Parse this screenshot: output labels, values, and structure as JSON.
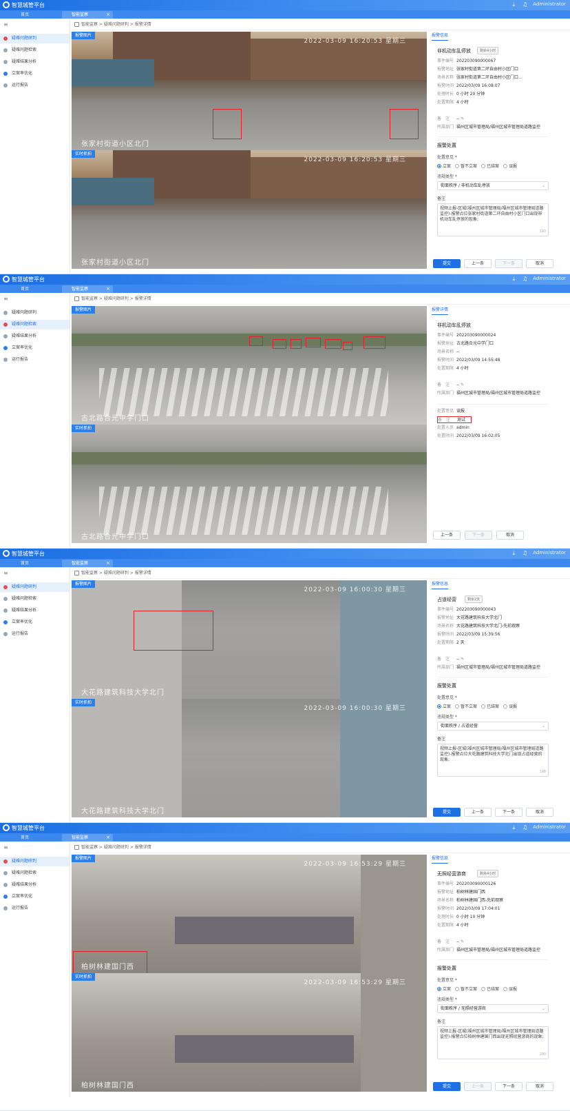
{
  "app": {
    "title": "智慧城管平台",
    "user": "Administrator",
    "download_icon": "download-icon",
    "bell_icon": "bell-icon"
  },
  "tabs": [
    "首页",
    "智能监察"
  ],
  "sidebar": {
    "items": [
      {
        "label": "疑难问题研判"
      },
      {
        "label": "疑难问题检索"
      },
      {
        "label": "疑难结果分析"
      },
      {
        "label": "立案率优化"
      },
      {
        "label": "运行报告"
      }
    ]
  },
  "breadcrumb": [
    "智能监察",
    "疑难问题研判",
    "报警详情"
  ],
  "image_labels": {
    "alarm": "报警图片",
    "live": "实时抓拍"
  },
  "panels": [
    {
      "active_menu": 0,
      "stamp": "2022-03-09 16:20:53 星期三",
      "caption": "张家村街道小区北门",
      "detail_tab": "报警信息",
      "title": "非机动车乱停放",
      "badge": "剩余4小时",
      "rows": [
        {
          "k": "事件编号",
          "v": "202203090000067"
        },
        {
          "k": "报警地址",
          "v": "张家村街道第二环自由村小区门口"
        },
        {
          "k": "场景名称",
          "v": "张家村街道第二环自由村小区门口..."
        },
        {
          "k": "报警时间",
          "v": "2022/03/09 16:08:07"
        },
        {
          "k": "处理时长",
          "v": "0 小时 20 分钟"
        },
        {
          "k": "处置期限",
          "v": "4 小时"
        }
      ],
      "rows2": [
        {
          "k": "备　注",
          "v": "--"
        },
        {
          "k": "所属部门",
          "v": "福州区城市管理局/福州区城市管理局道路监控"
        }
      ],
      "section": "报警处置",
      "field_label": "处置意见 *",
      "radios": [
        "立案",
        "暂不立案",
        "已结案",
        "误报"
      ],
      "type_label": "违规类型 *",
      "type_value": "街面秩序 / 非机动车乱停放",
      "note_label": "备注",
      "note": "视频上报-区城(福州区城市管理局/福州区城市管理局道路监控)-报警点位张家村街道第二环自由村小区门口出现非机动车乱停放的现象;",
      "count": "193",
      "buttons": [
        "提交",
        "上一条",
        "下一条",
        "取消"
      ]
    },
    {
      "active_menu": 1,
      "stamp": "",
      "caption": "古北路合光中学门口",
      "detail_tab": "报警详情",
      "title": "非机动车乱停放",
      "badge": "",
      "rows": [
        {
          "k": "事件编号",
          "v": "202203090000024"
        },
        {
          "k": "报警地址",
          "v": "古北路合光中学门口"
        },
        {
          "k": "场景名称",
          "v": "--"
        },
        {
          "k": "报警时间",
          "v": "2022/03/09 14:55:48"
        },
        {
          "k": "处置期限",
          "v": "4 小时"
        }
      ],
      "rows2": [
        {
          "k": "备　注",
          "v": "--"
        },
        {
          "k": "所属部门",
          "v": "福州区城市管理局/福州区城市管理局道路监控"
        }
      ],
      "rows3": [
        {
          "k": "处置意见",
          "v": "误报"
        },
        {
          "k": "备　注",
          "v": "测试"
        },
        {
          "k": "处置人员",
          "v": "admin"
        },
        {
          "k": "处置时间",
          "v": "2022/03/09 16:02:05"
        }
      ],
      "buttons": [
        "上一条",
        "下一条",
        "取消"
      ]
    },
    {
      "active_menu": 0,
      "stamp": "2022-03-09 16:00:30 星期三",
      "caption": "大花路建筑科技大学北门",
      "detail_tab": "报警信息",
      "title": "占道经营",
      "badge": "剩余2天",
      "rows": [
        {
          "k": "事件编号",
          "v": "202203090000043"
        },
        {
          "k": "报警地址",
          "v": "大花路建筑科技大学北门"
        },
        {
          "k": "场景名称",
          "v": "大花路建筑科技大学北门-先前观察"
        },
        {
          "k": "报警时间",
          "v": "2022/03/09 15:39:56"
        },
        {
          "k": "处置期限",
          "v": "2 天"
        }
      ],
      "rows2": [
        {
          "k": "备　注",
          "v": "--"
        },
        {
          "k": "所属部门",
          "v": "福州区城市管理局/福州区城市管理局道路监控"
        }
      ],
      "section": "报警处置",
      "field_label": "处置意见 *",
      "radios": [
        "立案",
        "暂不立案",
        "已结案",
        "误报"
      ],
      "type_label": "违规类型 *",
      "type_value": "街面秩序 / 占道经营",
      "note_label": "备注",
      "note": "视频上报-区城(福州区城市管理局/福州区城市管理局道路监控)-报警点位大花路建筑科技大学北门出现占道经营的现象;",
      "count": "198",
      "buttons": [
        "提交",
        "上一条",
        "下一条",
        "取消"
      ]
    },
    {
      "active_menu": 0,
      "stamp": "2022-03-09 16:53:29 星期三",
      "caption": "柏树林建国门西",
      "detail_tab": "报警信息",
      "title": "无照经营游商",
      "badge": "剩余4小时",
      "rows": [
        {
          "k": "事件编号",
          "v": "202203090000126"
        },
        {
          "k": "报警地址",
          "v": "柏树林建国门西"
        },
        {
          "k": "场景名称",
          "v": "柏树林建国门西-先前观察"
        },
        {
          "k": "报警时间",
          "v": "2022/03/09 17:04:01"
        },
        {
          "k": "处理时长",
          "v": "0 小时 10 分钟"
        },
        {
          "k": "处置期限",
          "v": "4 小时"
        }
      ],
      "rows2": [
        {
          "k": "备　注",
          "v": "--"
        },
        {
          "k": "所属部门",
          "v": "福州区城市管理局/福州区城市管理局道路监控"
        }
      ],
      "section": "报警处置",
      "field_label": "处置意见 *",
      "radios": [
        "立案",
        "暂不立案",
        "已结案",
        "误报"
      ],
      "type_label": "违规类型 *",
      "type_value": "街面秩序 / 无照经营游商",
      "note_label": "备注",
      "note": "视频上报-区城(福州区城市管理局/福州区城市管理局道路监控)-报警点位柏树林建国门西出现无照经营游商的现象;",
      "count": "200",
      "buttons": [
        "提交",
        "上一条",
        "下一条",
        "取消"
      ]
    }
  ]
}
